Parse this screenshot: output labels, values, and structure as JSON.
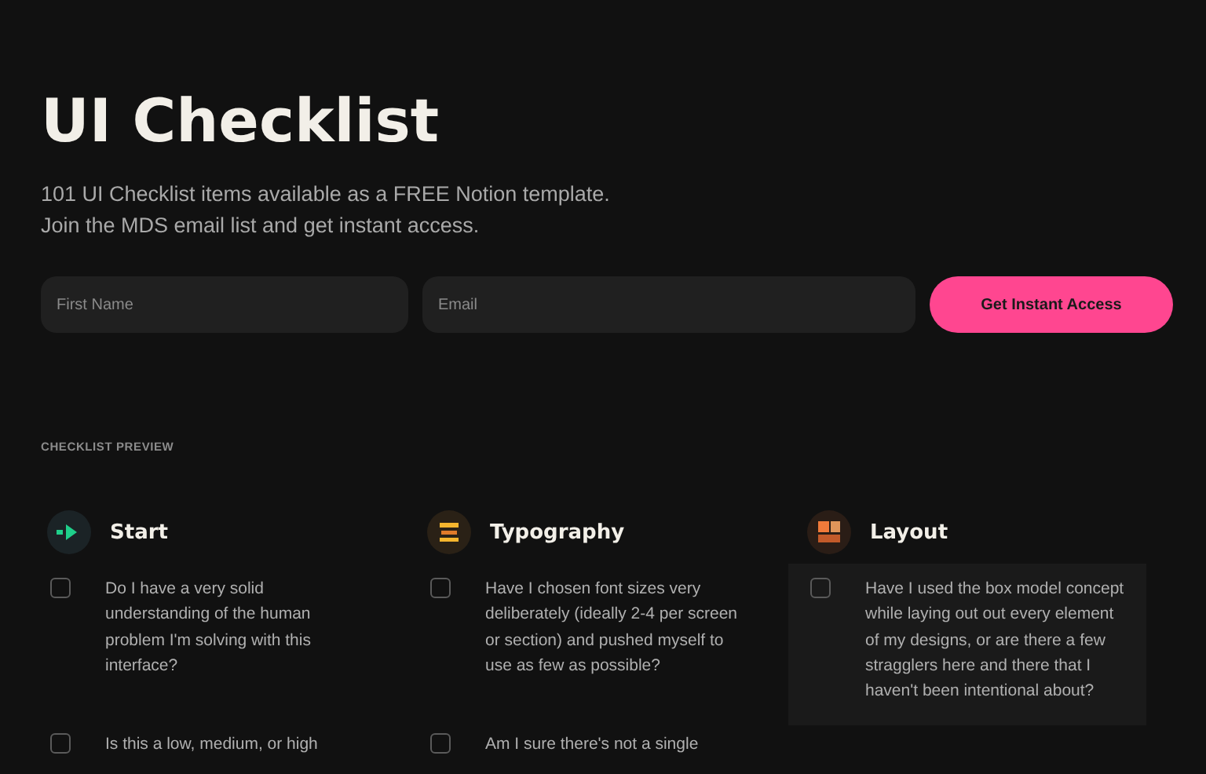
{
  "title": "UI Checklist",
  "intro": [
    "101 UI Checklist items available as a FREE Notion template.",
    "Join the MDS email list and get instant access."
  ],
  "form": {
    "fields": [
      {
        "placeholder": "First Name",
        "kind": "name"
      },
      {
        "placeholder": "Email",
        "kind": "email"
      }
    ],
    "button": "Get Instant Access"
  },
  "preview_label": "CHECKLIST PREVIEW",
  "sections": [
    {
      "title": "Start",
      "kind": "start",
      "items": [
        {
          "text": "Do I have a very solid understanding of the human problem I'm solving with this interface?",
          "checked": false,
          "highlighted": false
        },
        {
          "text": "Is this a low, medium, or high",
          "checked": false,
          "highlighted": false
        }
      ]
    },
    {
      "title": "Typography",
      "kind": "typography",
      "items": [
        {
          "text": "Have I chosen font sizes very deliberately (ideally 2-4 per screen or section) and pushed myself to use as few as possible?",
          "checked": false,
          "highlighted": false
        },
        {
          "text": "Am I sure there's not a single",
          "checked": false,
          "highlighted": false
        }
      ]
    },
    {
      "title": "Layout",
      "kind": "layout",
      "items": [
        {
          "text": "Have I used the box model concept while laying out out every element of my designs, or are there a few stragglers here and there that I haven't been intentional about?",
          "checked": false,
          "highlighted": true
        }
      ]
    }
  ]
}
